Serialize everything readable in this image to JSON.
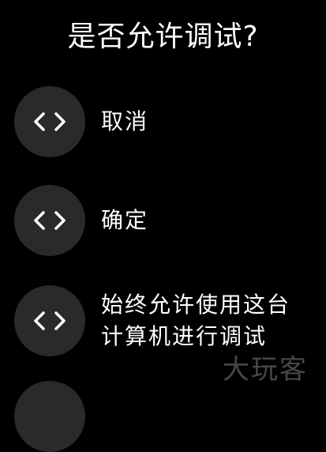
{
  "dialog": {
    "title": "是否允许调试?",
    "options": [
      {
        "icon": "code-brackets-icon",
        "label_lines": [
          "取消"
        ]
      },
      {
        "icon": "code-brackets-icon",
        "label_lines": [
          "确定"
        ]
      },
      {
        "icon": "code-brackets-icon",
        "label_lines": [
          "始终允许使用这台",
          "计算机进行调试"
        ]
      }
    ]
  },
  "watermark": {
    "text": "大玩客"
  },
  "colors": {
    "background": "#000000",
    "icon_circle": "#2a2a2a",
    "text": "#ffffff"
  }
}
